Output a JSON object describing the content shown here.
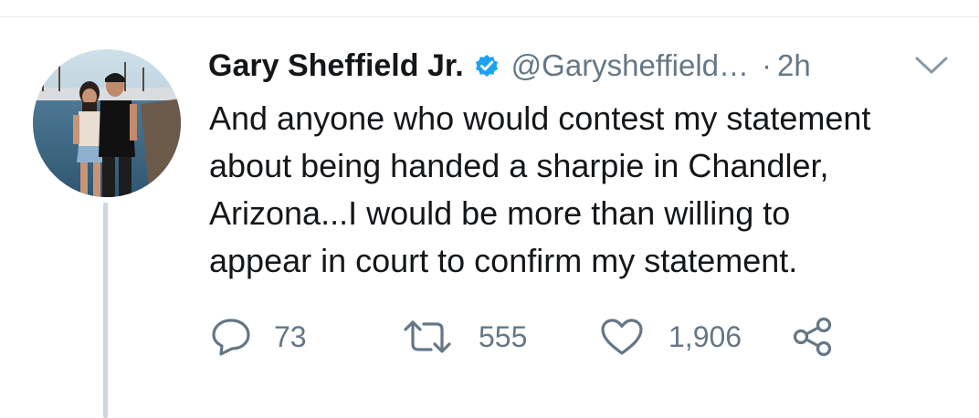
{
  "tweet": {
    "author": {
      "display_name": "Gary Sheffield Jr.",
      "handle": "@Garysheffield…",
      "verified": true,
      "avatar_icon": "profile-photo"
    },
    "separator": "·",
    "timestamp": "2h",
    "text": "And anyone who would contest my statement\nabout being handed a sharpie in Chandler,\nArizona...I would be more than willing to\nappear in court to confirm my statement.",
    "actions": {
      "reply": {
        "icon": "reply-icon",
        "count": "73"
      },
      "retweet": {
        "icon": "retweet-icon",
        "count": "555"
      },
      "like": {
        "icon": "heart-icon",
        "count": "1,906"
      },
      "share": {
        "icon": "share-icon"
      }
    },
    "menu_icon": "chevron-down-icon"
  },
  "colors": {
    "text_primary": "#14171a",
    "text_secondary": "#657786",
    "verified_blue": "#1da1f2",
    "divider": "#e6ecf0",
    "thread_line": "#ccd6dd"
  }
}
